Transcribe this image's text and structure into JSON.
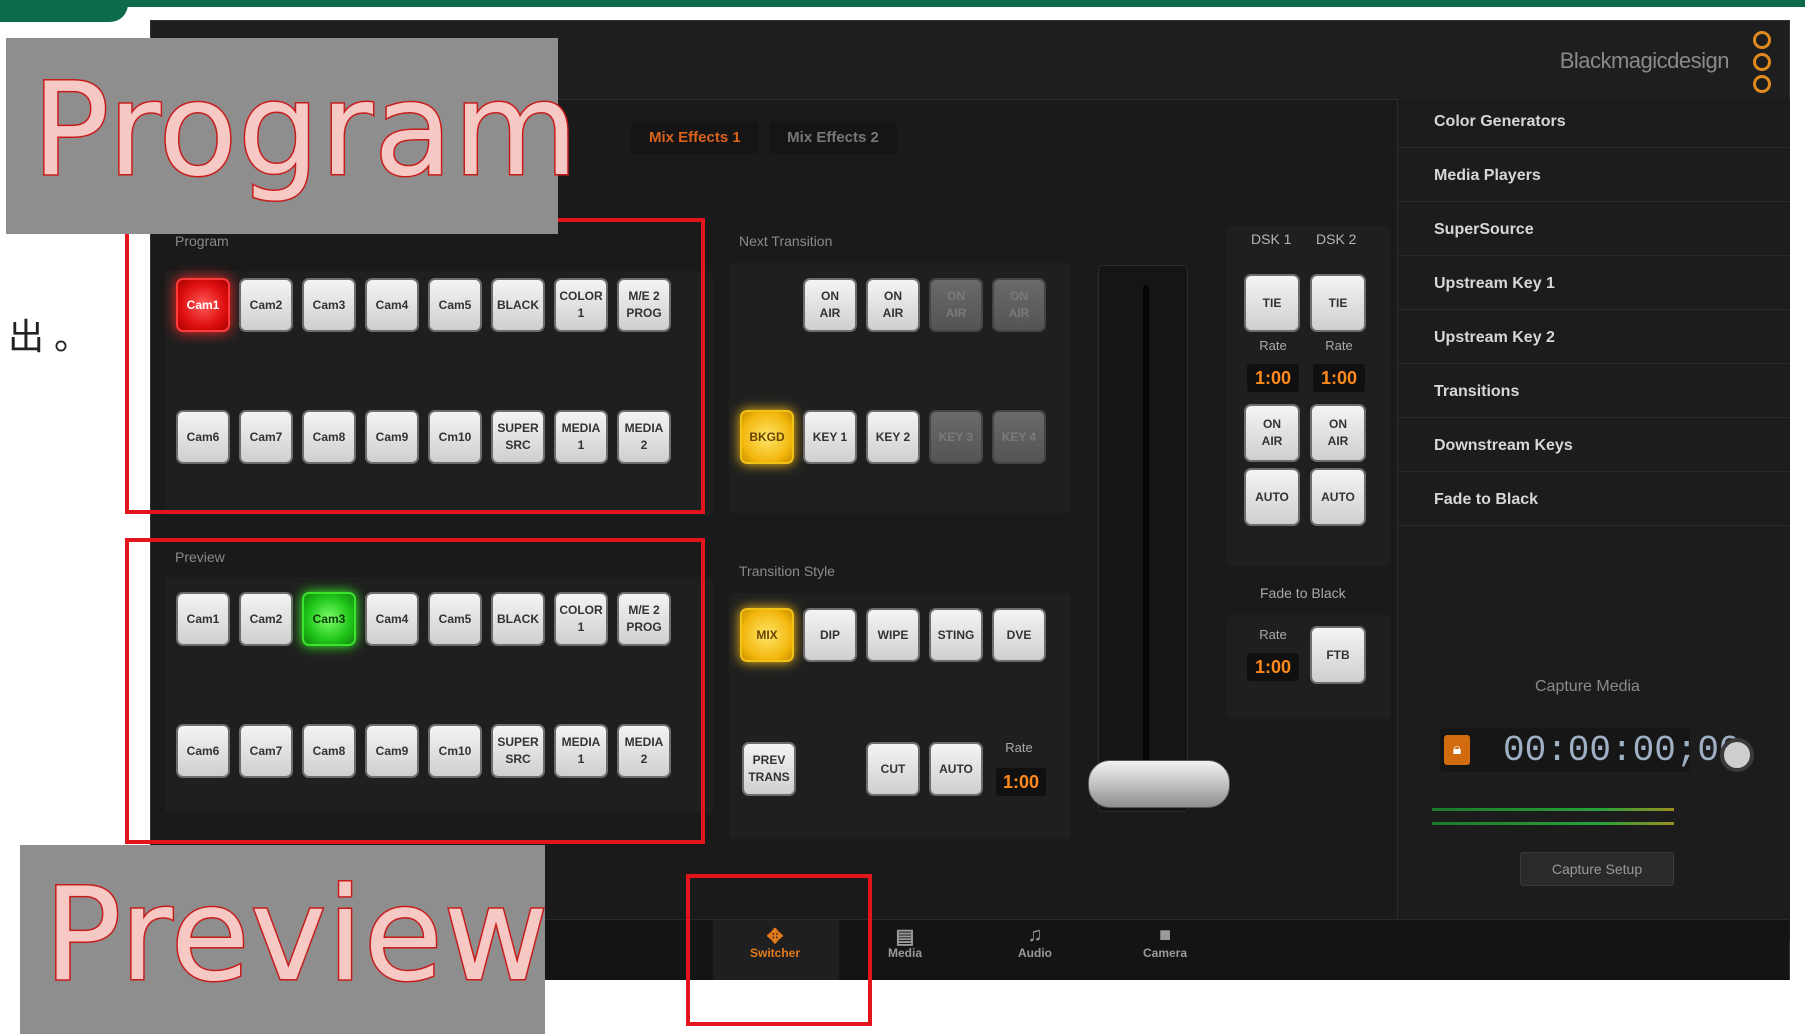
{
  "app": {
    "brand": "Blackmagicdesign"
  },
  "me_tabs": [
    "Mix Effects 1",
    "Mix Effects 2"
  ],
  "overlay": {
    "program_title": "Program",
    "preview_title": "Preview",
    "side_text": "出 。"
  },
  "program": {
    "label": "Program",
    "row1": [
      "Cam1",
      "Cam2",
      "Cam3",
      "Cam4",
      "Cam5",
      "BLACK",
      "COLOR\n1",
      "M/E 2\nPROG"
    ],
    "row2": [
      "Cam6",
      "Cam7",
      "Cam8",
      "Cam9",
      "Cm10",
      "SUPER\nSRC",
      "MEDIA\n1",
      "MEDIA\n2"
    ],
    "active": "Cam1"
  },
  "preview": {
    "label": "Preview",
    "row1": [
      "Cam1",
      "Cam2",
      "Cam3",
      "Cam4",
      "Cam5",
      "BLACK",
      "COLOR\n1",
      "M/E 2\nPROG"
    ],
    "row2": [
      "Cam6",
      "Cam7",
      "Cam8",
      "Cam9",
      "Cm10",
      "SUPER\nSRC",
      "MEDIA\n1",
      "MEDIA\n2"
    ],
    "active": "Cam3"
  },
  "next_transition": {
    "label": "Next Transition",
    "top": [
      "ON\nAIR",
      "ON\nAIR",
      "ON\nAIR",
      "ON\nAIR"
    ],
    "bottom": [
      "BKGD",
      "KEY 1",
      "KEY 2",
      "KEY 3",
      "KEY 4"
    ]
  },
  "transition_style": {
    "label": "Transition Style",
    "styles": [
      "MIX",
      "DIP",
      "WIPE",
      "STING",
      "DVE"
    ],
    "prev_trans": "PREV\nTRANS",
    "cut": "CUT",
    "auto": "AUTO",
    "rate_label": "Rate",
    "rate": "1:00"
  },
  "dsk": {
    "headers": [
      "DSK 1",
      "DSK 2"
    ],
    "tie": "TIE",
    "rate_label": "Rate",
    "rates": [
      "1:00",
      "1:00"
    ],
    "on_air": "ON\nAIR",
    "auto": "AUTO"
  },
  "ftb": {
    "label": "Fade to Black",
    "rate_label": "Rate",
    "rate": "1:00",
    "button": "FTB"
  },
  "sidebar": [
    "Color Generators",
    "Media Players",
    "SuperSource",
    "Upstream Key 1",
    "Upstream Key 2",
    "Transitions",
    "Downstream Keys",
    "Fade to Black"
  ],
  "capture": {
    "title": "Capture Media",
    "timecode": "00:00:00;00",
    "setup": "Capture Setup"
  },
  "bottom_nav": [
    "Switcher",
    "Media",
    "Audio",
    "Camera"
  ]
}
